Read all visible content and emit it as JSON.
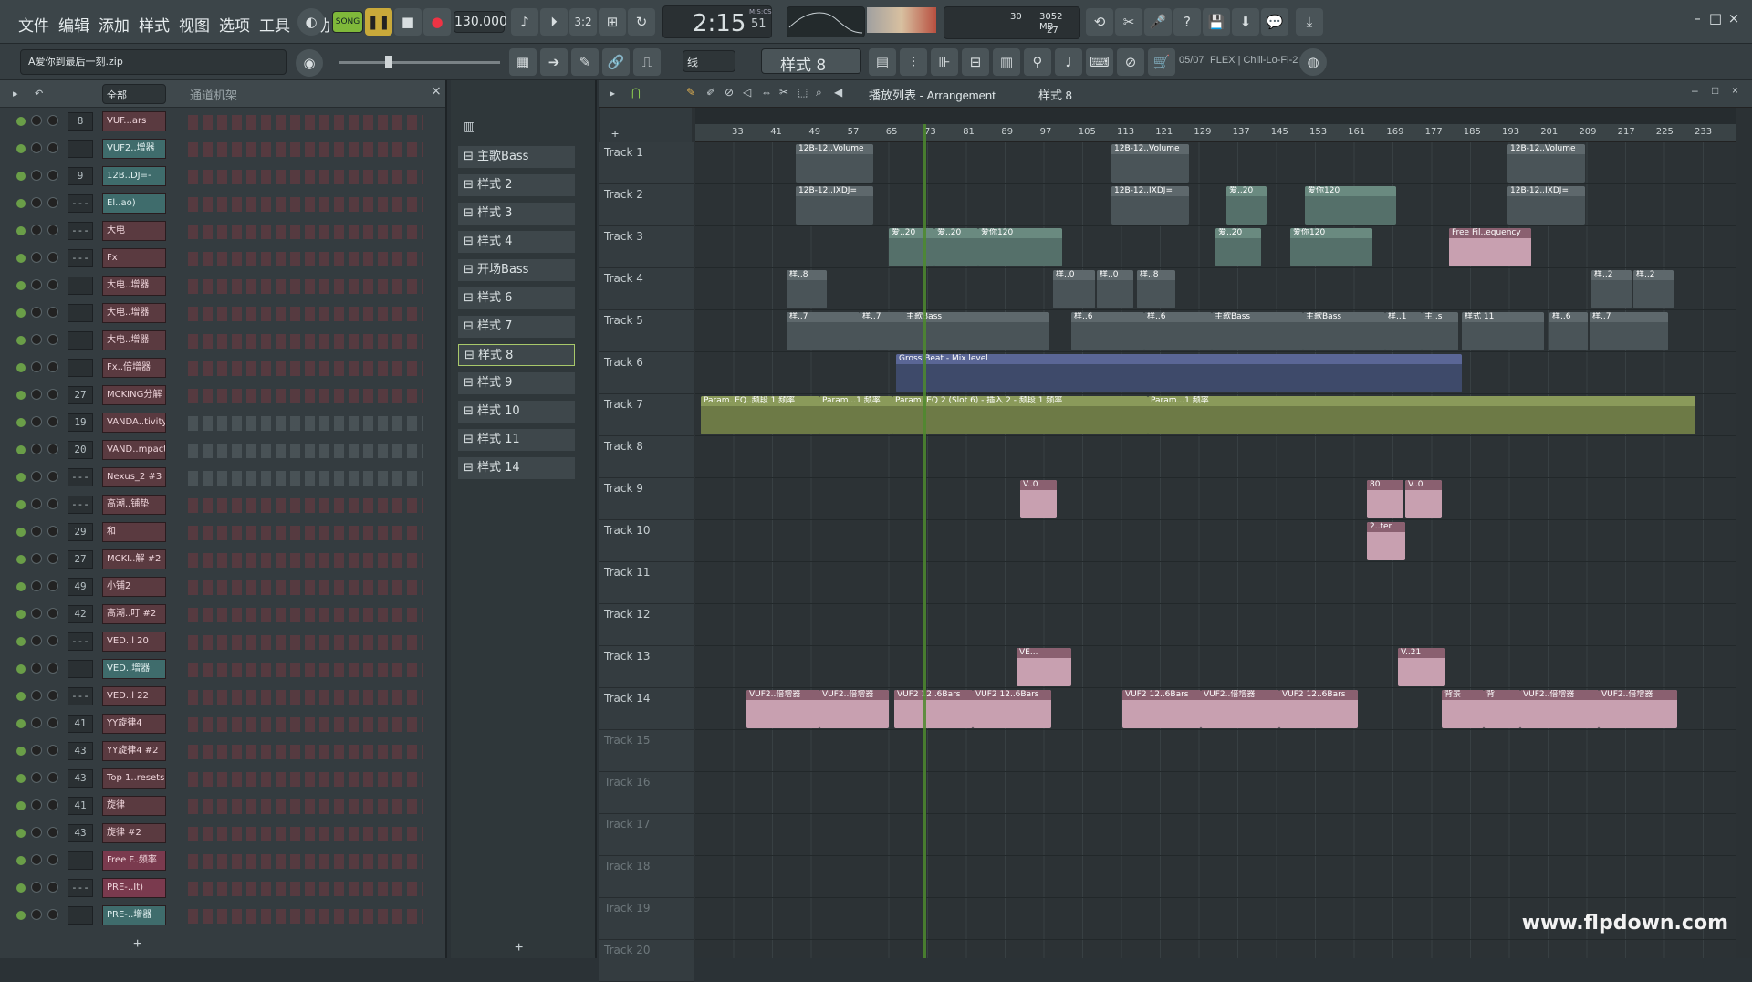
{
  "menu": [
    "文件",
    "编辑",
    "添加",
    "样式",
    "视图",
    "选项",
    "工具",
    "帮助"
  ],
  "transport": {
    "song_mode": "SONG",
    "tempo": "130.000",
    "time": "2:15",
    "time_sub": "51",
    "time_unit": "M:S:CS",
    "cpu": "30",
    "ram": "3052 MB",
    "polyphony": "27"
  },
  "hint_file": "A爱你到最后一刻.zip",
  "snap": "线",
  "pattern_selector": "样式 8",
  "news": {
    "count": "05/07",
    "text": "FLEX | Chill-Lo-Fi-2"
  },
  "channel_rack": {
    "filter": "全部",
    "title": "通道机架"
  },
  "channels": [
    {
      "mix": "8",
      "name": "VUF...ars"
    },
    {
      "mix": "",
      "name": "VUF2..增器"
    },
    {
      "mix": "9",
      "name": "12B..DJ=-"
    },
    {
      "mix": "---",
      "name": "El..ao)"
    },
    {
      "mix": "---",
      "name": "大电"
    },
    {
      "mix": "---",
      "name": "Fx"
    },
    {
      "mix": "",
      "name": "大电..增器"
    },
    {
      "mix": "",
      "name": "大电..增器"
    },
    {
      "mix": "",
      "name": "大电..增器"
    },
    {
      "mix": "",
      "name": "Fx..倍增器"
    },
    {
      "mix": "27",
      "name": "MCKING分解"
    },
    {
      "mix": "19",
      "name": "VANDA..tivity"
    },
    {
      "mix": "20",
      "name": "VAND..mpact"
    },
    {
      "mix": "---",
      "name": "Nexus_2 #3"
    },
    {
      "mix": "---",
      "name": "高潮..铺垫"
    },
    {
      "mix": "29",
      "name": "和"
    },
    {
      "mix": "27",
      "name": "MCKI..解 #2"
    },
    {
      "mix": "49",
      "name": "小铺2"
    },
    {
      "mix": "42",
      "name": "高潮..叮 #2"
    },
    {
      "mix": "---",
      "name": "VED..l 20"
    },
    {
      "mix": "",
      "name": "VED..增器"
    },
    {
      "mix": "---",
      "name": "VED..l 22"
    },
    {
      "mix": "41",
      "name": "YY旋律4"
    },
    {
      "mix": "43",
      "name": "YY旋律4 #2"
    },
    {
      "mix": "43",
      "name": "Top 1..resets"
    },
    {
      "mix": "41",
      "name": "旋律"
    },
    {
      "mix": "43",
      "name": "旋律 #2"
    },
    {
      "mix": "",
      "name": "Free F..频率"
    },
    {
      "mix": "---",
      "name": "PRE-..It)"
    },
    {
      "mix": "",
      "name": "PRE-..增器"
    }
  ],
  "patterns": [
    "主歌Bass",
    "样式 2",
    "样式 3",
    "样式 4",
    "开场Bass",
    "样式 6",
    "样式 7",
    "样式 8",
    "样式 9",
    "样式 10",
    "样式 11",
    "样式 14"
  ],
  "playlist": {
    "title": "播放列表 - Arrangement",
    "pattern": "样式 8"
  },
  "ruler_ticks": [
    "33",
    "41",
    "49",
    "57",
    "65",
    "73",
    "81",
    "89",
    "97",
    "105",
    "113",
    "121",
    "129",
    "137",
    "145",
    "153",
    "161",
    "169",
    "177",
    "185",
    "193",
    "201",
    "209",
    "217",
    "225",
    "233"
  ],
  "tracks": [
    "Track 1",
    "Track 2",
    "Track 3",
    "Track 4",
    "Track 5",
    "Track 6",
    "Track 7",
    "Track 8",
    "Track 9",
    "Track 10",
    "Track 11",
    "Track 12",
    "Track 13",
    "Track 14",
    "Track 15",
    "Track 16",
    "Track 17",
    "Track 18",
    "Track 19",
    "Track 20"
  ],
  "clips": {
    "t1": [
      "12B-12..Volume",
      "12B-12..Volume",
      "12B-12..Volume"
    ],
    "t2": [
      "12B-12..IXDJ=",
      "12B-12..IXDJ=",
      "爱..20",
      "爱你120",
      "12B-12..IXDJ="
    ],
    "t3": [
      "爱..20",
      "爱..20",
      "爱你120",
      "爱..20",
      "爱你120",
      "Free Fil..equency"
    ],
    "t4": [
      "样..8",
      "样..0",
      "样..0",
      "样..8",
      "样..2",
      "样..2"
    ],
    "t5": [
      "样..7",
      "样..7",
      "主歌Bass",
      "样..6",
      "样..6",
      "主歌Bass",
      "主歌Bass",
      "样..1",
      "主..s",
      "样式 11",
      "样..6",
      "样..7"
    ],
    "t6": [
      "Gross Beat - Mix level"
    ],
    "t7": [
      "Param. EQ..频段 1 频率",
      "Param...1 频率",
      "Param. EQ 2 (Slot 6) - 插入 2 - 频段 1 频率",
      "Param...1 频率"
    ],
    "t9": [
      "V..0",
      "80",
      "V..0"
    ],
    "t10": [
      "2..ter"
    ],
    "t13": [
      "VE...",
      "V..21"
    ],
    "t14": [
      "VUF2..倍增器",
      "VUF2..倍增器",
      "VUF2 12..6Bars",
      "VUF2 12..6Bars",
      "VUF2 12..6Bars",
      "VUF2..倍增器",
      "VUF2 12..6Bars",
      "背景",
      "背",
      "VUF2..倍增器",
      "VUF2..倍增器"
    ]
  },
  "watermark": "www.flpdown.com"
}
